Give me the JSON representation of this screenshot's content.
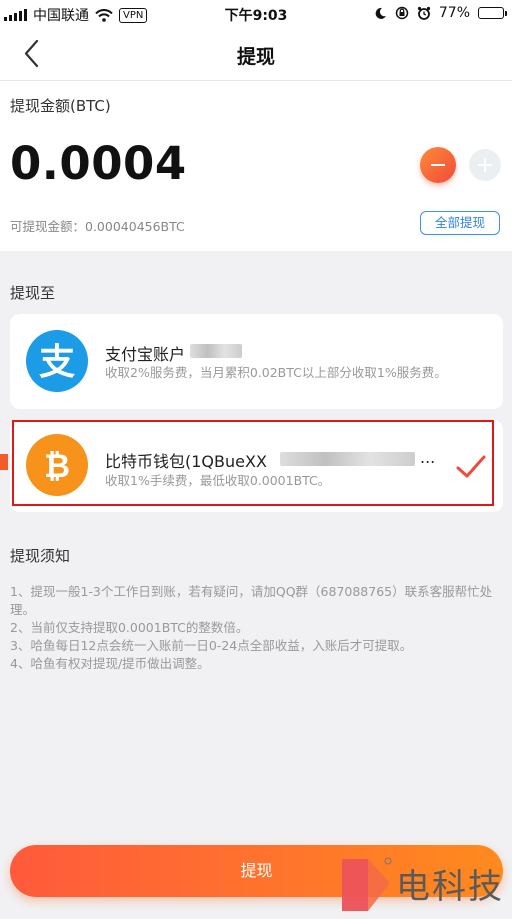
{
  "status_bar": {
    "carrier": "中国联通",
    "vpn": "VPN",
    "time": "下午9:03",
    "battery": "77%",
    "battery_level": 0.77
  },
  "nav": {
    "title": "提现"
  },
  "amount": {
    "label": "提现金额(BTC)",
    "value": "0.0004",
    "available": "可提现金额：0.00040456BTC",
    "all_button": "全部提现"
  },
  "withdraw_to": {
    "label": "提现至",
    "options": [
      {
        "name": "支付宝账户",
        "desc": "收取2%服务费，当月累积0.02BTC以上部分收取1%服务费。",
        "icon": "alipay-icon"
      },
      {
        "name": "比特币钱包(1QBueXX",
        "name_tail": "...",
        "desc": "收取1%手续费，最低收取0.0001BTC。",
        "icon": "bitcoin-icon",
        "selected": true
      }
    ]
  },
  "notes": {
    "title": "提现须知",
    "items": [
      "1、提现一般1-3个工作日到账，若有疑问，请加QQ群（687088765）联系客服帮忙处理。",
      "2、当前仅支持提取0.0001BTC的整数倍。",
      "3、哈鱼每日12点会统一入账前一日0-24点全部收益，入账后才可提取。",
      "4、哈鱼有权对提现/提币做出调整。"
    ]
  },
  "submit_label": "提现",
  "watermark": {
    "text": "电科技"
  },
  "colors": {
    "accent": "#ff6a2f",
    "link_blue": "#2f82ea",
    "alipay": "#1c9be6",
    "bitcoin": "#f7931a",
    "selected_border": "#e01818"
  }
}
